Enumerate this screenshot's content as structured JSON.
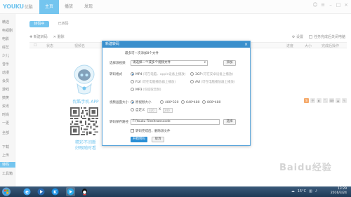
{
  "app": {
    "logo": "YOUKU",
    "logo_cn": "优酷",
    "top_tabs": [
      "主页",
      "播放",
      "发现"
    ],
    "active_tab": 0
  },
  "sidebar": {
    "items": [
      "精选",
      "电视剧",
      "电影",
      "综艺",
      "少儿",
      "音乐",
      "动漫",
      "会员",
      "游戏",
      "搞笑",
      "资讯",
      "时尚",
      "一更",
      "全部",
      "下载",
      "上传",
      "转码",
      "工具箱"
    ],
    "active_index": 16
  },
  "main": {
    "subtabs": [
      "转码中",
      "已转码"
    ],
    "toolbar": {
      "new_task": "新建转码",
      "delete": "删除"
    },
    "settings_label": "设置",
    "shutdown_label": "任务完成后关闭电脑",
    "table_headers": [
      "状态",
      "视频名",
      "进度",
      "大小",
      "完成后操作"
    ]
  },
  "promo": {
    "title": "优酷手机 APP",
    "line1": "精彩不间断",
    "line2": "好眼随时看"
  },
  "dialog": {
    "title": "新建转码",
    "close": "×",
    "note": "最多可一次添加8个文件",
    "select_label": "选择源视频",
    "select_value": "请选择一个或多个视频文件",
    "add_button": "添加",
    "format_label": "转码格式",
    "formats": [
      {
        "name": "MP4",
        "hint": "(可在电脑、apple设备上播放)",
        "selected": true
      },
      {
        "name": "3GP",
        "hint": "(可在安卓设备上播放)",
        "selected": false
      },
      {
        "name": "FLV",
        "hint": "(可在电脑播放器上播放)",
        "selected": false
      },
      {
        "name": "AVI",
        "hint": "(可在电脑播放器上播放)",
        "selected": false
      },
      {
        "name": "MP3",
        "hint": "(仅提取音频)",
        "selected": false
      }
    ],
    "size_label": "视频画面大小",
    "sizes": [
      {
        "name": "原视频大小",
        "selected": true
      },
      {
        "name": "480*320",
        "selected": false
      },
      {
        "name": "640*480",
        "selected": false
      },
      {
        "name": "800*480",
        "selected": false
      }
    ],
    "custom_label": "自定义",
    "custom_width": "320",
    "custom_height": "240",
    "custom_sep": "X",
    "save_label": "转码保存路径",
    "save_path": "F:\\Youku Files\\transcode",
    "browse_button": "选择",
    "after_option": "转码完成后，删除源文件",
    "start_button": "开始转码",
    "cancel_button": "取消"
  },
  "taskbar": {
    "time": "13:29",
    "date": "2016/3/24",
    "temperature": "15°C"
  },
  "watermark": "Baidu经验",
  "colors": {
    "accent": "#2aa7e6",
    "dialog_title": "#3a8fcc",
    "primary_button": "#2a8fd6"
  }
}
